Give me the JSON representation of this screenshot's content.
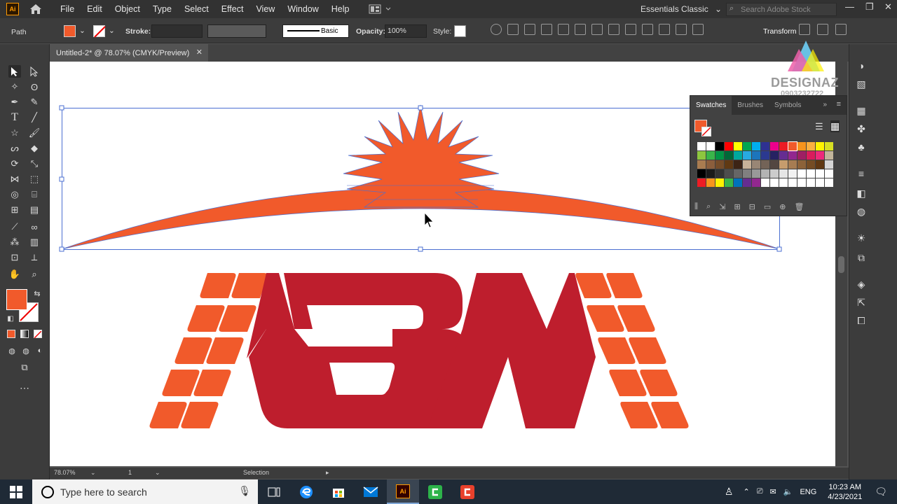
{
  "menubar": {
    "app_logo": "Ai",
    "items": [
      "File",
      "Edit",
      "Object",
      "Type",
      "Select",
      "Effect",
      "View",
      "Window",
      "Help"
    ],
    "workspace": "Essentials Classic",
    "search_placeholder": "Search Adobe Stock"
  },
  "controlbar": {
    "selection_type": "Path",
    "stroke_label": "Stroke:",
    "brush_style": "Basic",
    "opacity_label": "Opacity:",
    "opacity_value": "100%",
    "style_label": "Style:",
    "transform_label": "Transform",
    "fill_color": "#f15a2b"
  },
  "document": {
    "tab_title": "Untitled-2* @ 78.07% (CMYK/Preview)",
    "close": "✕"
  },
  "statusbar": {
    "zoom": "78.07%",
    "artboard_number": "1",
    "tool_status": "Selection"
  },
  "swatches_panel": {
    "tabs": [
      "Swatches",
      "Brushes",
      "Symbols"
    ],
    "active_tab": "Swatches",
    "swatch_colors": [
      "#ffffff",
      "#ffffff",
      "#000000",
      "#ff0000",
      "#ffff00",
      "#00a651",
      "#00aeef",
      "#2e3192",
      "#ec008c",
      "#ed1c24",
      "#f15a2b",
      "#f7941d",
      "#fbb040",
      "#fff200",
      "#d7df23",
      "#8dc63f",
      "#39b54a",
      "#009444",
      "#006838",
      "#00a99d",
      "#27aae1",
      "#1c75bc",
      "#2b3990",
      "#262262",
      "#662d91",
      "#92278f",
      "#9e1f63",
      "#da1c5c",
      "#ee2a7b",
      "#c2b59b",
      "#a97c50",
      "#8b5e3c",
      "#754c29",
      "#603913",
      "#3c2415",
      "#c7b299",
      "#998675",
      "#736357",
      "#534741",
      "#c69c6d",
      "#a67c52",
      "#8c6239",
      "#754c24",
      "#603813",
      "#d6d6d6",
      "#000000",
      "#1a1a1a",
      "#333333",
      "#4d4d4d",
      "#666666",
      "#808080",
      "#999999",
      "#b3b3b3",
      "#cccccc",
      "#e6e6e6",
      "#f2f2f2",
      "#ffffff",
      "#ffffff",
      "#ffffff",
      "#ffffff",
      "#ed1c24",
      "#f7941d",
      "#fff200",
      "#39b54a",
      "#0072bc",
      "#662d91",
      "#92278f",
      "#ffffff",
      "#ffffff",
      "#ffffff",
      "#ffffff",
      "#ffffff",
      "#ffffff",
      "#ffffff",
      "#ffffff"
    ]
  },
  "watermark": {
    "brand": "DESIGNAZ",
    "phone": "0903232722"
  },
  "artwork": {
    "sun_color": "#f15a2b",
    "letters_color": "#be1e2d",
    "tiles_color": "#f15a2b"
  },
  "taskbar": {
    "search_placeholder": "Type here to search",
    "language": "ENG",
    "time": "10:23 AM",
    "date": "4/23/2021"
  }
}
